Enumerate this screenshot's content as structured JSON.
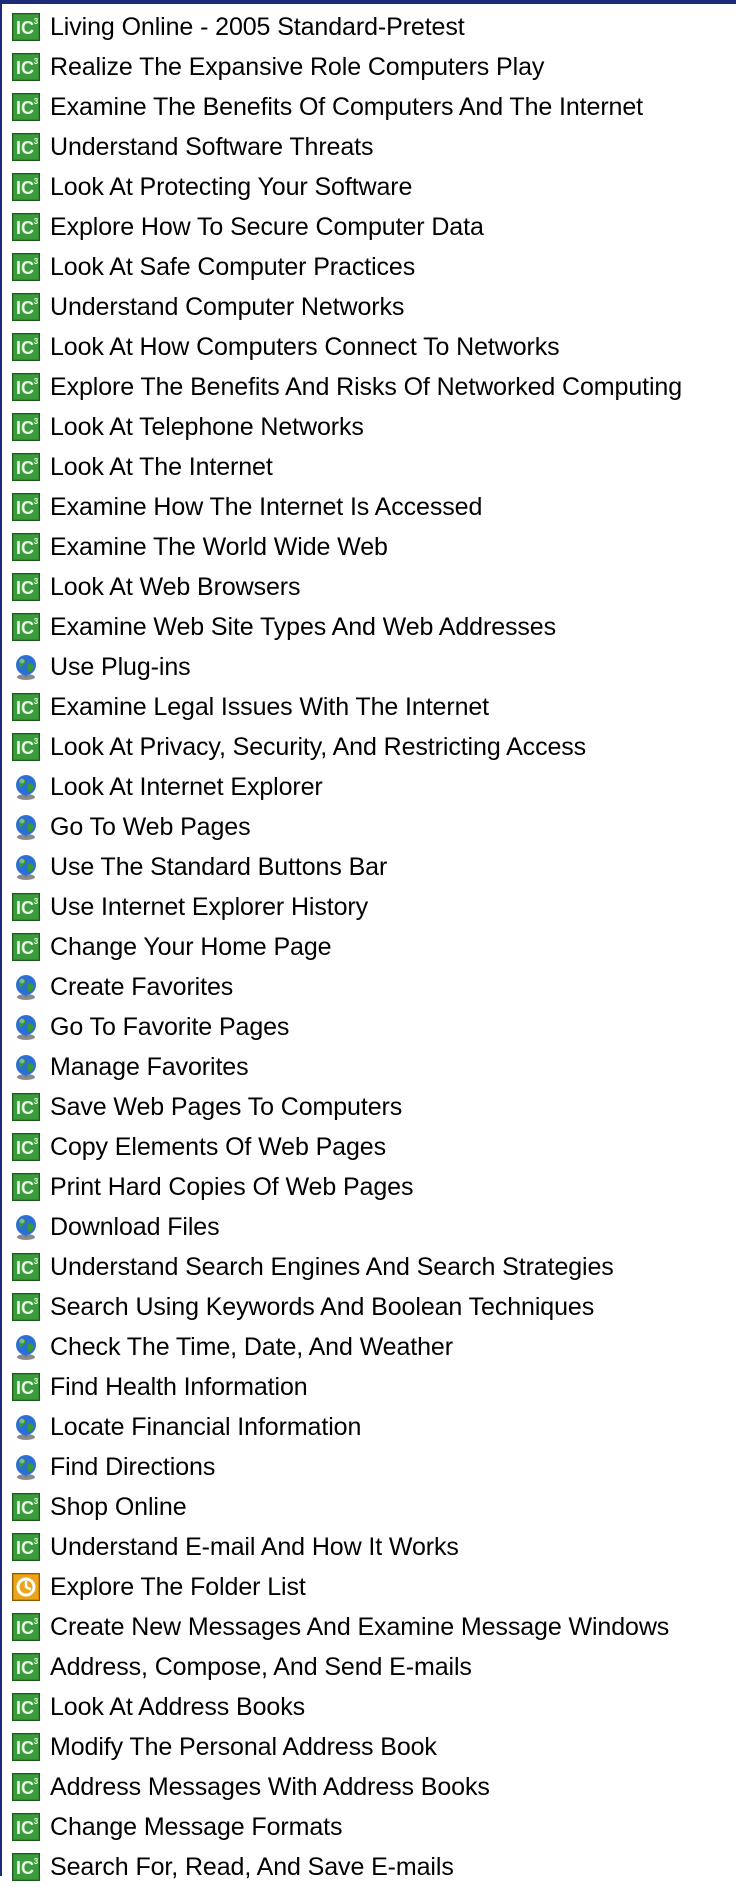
{
  "lessons": [
    {
      "label": "Living Online - 2005 Standard-Pretest",
      "icon": "ic3-course-icon"
    },
    {
      "label": "Realize The Expansive Role Computers Play",
      "icon": "ic3-course-icon"
    },
    {
      "label": "Examine The Benefits Of Computers And The Internet",
      "icon": "ic3-course-icon"
    },
    {
      "label": "Understand Software Threats",
      "icon": "ic3-course-icon"
    },
    {
      "label": "Look At Protecting Your Software",
      "icon": "ic3-course-icon"
    },
    {
      "label": "Explore How To Secure Computer Data",
      "icon": "ic3-course-icon"
    },
    {
      "label": "Look At Safe Computer Practices",
      "icon": "ic3-course-icon"
    },
    {
      "label": "Understand Computer Networks",
      "icon": "ic3-course-icon"
    },
    {
      "label": "Look At How Computers Connect To Networks",
      "icon": "ic3-course-icon"
    },
    {
      "label": "Explore The Benefits And Risks Of Networked Computing",
      "icon": "ic3-course-icon"
    },
    {
      "label": "Look At Telephone Networks",
      "icon": "ic3-course-icon"
    },
    {
      "label": "Look At The Internet",
      "icon": "ic3-course-icon"
    },
    {
      "label": "Examine How The Internet Is Accessed",
      "icon": "ic3-course-icon"
    },
    {
      "label": "Examine The World Wide Web",
      "icon": "ic3-course-icon"
    },
    {
      "label": "Look At Web Browsers",
      "icon": "ic3-course-icon"
    },
    {
      "label": "Examine Web Site Types And Web Addresses",
      "icon": "ic3-course-icon"
    },
    {
      "label": "Use Plug-ins",
      "icon": "globe-icon"
    },
    {
      "label": "Examine Legal Issues With The Internet",
      "icon": "ic3-course-icon"
    },
    {
      "label": "Look At Privacy, Security, And Restricting Access",
      "icon": "ic3-course-icon"
    },
    {
      "label": "Look At Internet Explorer",
      "icon": "globe-icon"
    },
    {
      "label": "Go To Web Pages",
      "icon": "globe-icon"
    },
    {
      "label": "Use The Standard Buttons Bar",
      "icon": "globe-icon"
    },
    {
      "label": "Use Internet Explorer History",
      "icon": "ic3-course-icon"
    },
    {
      "label": "Change Your Home Page",
      "icon": "ic3-course-icon"
    },
    {
      "label": "Create Favorites",
      "icon": "globe-icon"
    },
    {
      "label": "Go To Favorite Pages",
      "icon": "globe-icon"
    },
    {
      "label": "Manage Favorites",
      "icon": "globe-icon"
    },
    {
      "label": "Save Web Pages To Computers",
      "icon": "ic3-course-icon"
    },
    {
      "label": "Copy Elements Of Web Pages",
      "icon": "ic3-course-icon"
    },
    {
      "label": "Print Hard Copies Of Web Pages",
      "icon": "ic3-course-icon"
    },
    {
      "label": "Download Files",
      "icon": "globe-icon"
    },
    {
      "label": "Understand Search Engines And Search Strategies",
      "icon": "ic3-course-icon"
    },
    {
      "label": "Search Using Keywords And Boolean Techniques",
      "icon": "ic3-course-icon"
    },
    {
      "label": "Check The Time, Date, And Weather",
      "icon": "globe-icon"
    },
    {
      "label": "Find Health Information",
      "icon": "ic3-course-icon"
    },
    {
      "label": "Locate Financial Information",
      "icon": "globe-icon"
    },
    {
      "label": "Find Directions",
      "icon": "globe-icon"
    },
    {
      "label": "Shop Online",
      "icon": "ic3-course-icon"
    },
    {
      "label": "Understand E-mail And How It Works",
      "icon": "ic3-course-icon"
    },
    {
      "label": "Explore The Folder List",
      "icon": "outlook-icon"
    },
    {
      "label": "Create New Messages And Examine Message Windows",
      "icon": "ic3-course-icon"
    },
    {
      "label": "Address, Compose, And Send E-mails",
      "icon": "ic3-course-icon"
    },
    {
      "label": "Look At Address Books",
      "icon": "ic3-course-icon"
    },
    {
      "label": "Modify The Personal Address Book",
      "icon": "ic3-course-icon"
    },
    {
      "label": "Address Messages With Address Books",
      "icon": "ic3-course-icon"
    },
    {
      "label": "Change Message Formats",
      "icon": "ic3-course-icon"
    },
    {
      "label": "Search For, Read, And Save E-mails",
      "icon": "ic3-course-icon"
    }
  ],
  "colors": {
    "frame": "#1c2a78",
    "ic3_green": "#2f8a2f",
    "ic3_text": "#e8f4e8",
    "globe_blue": "#2a6fd1",
    "globe_green": "#3a9b2f",
    "outlook_orange": "#d98a00"
  }
}
